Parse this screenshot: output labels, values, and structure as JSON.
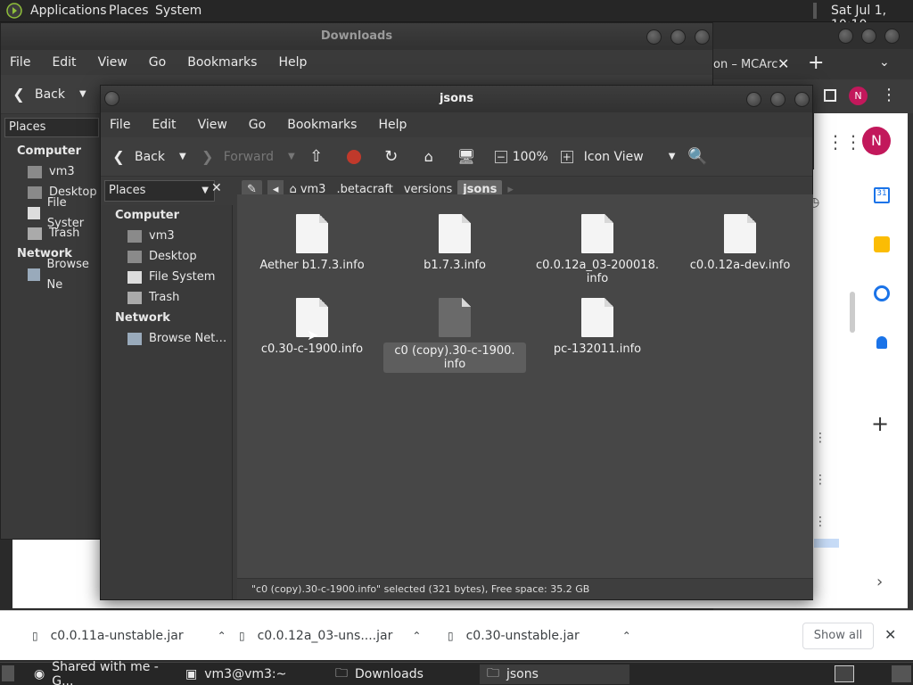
{
  "top_panel": {
    "applications": "Applications",
    "places": "Places",
    "system": "System",
    "clock": "Sat Jul 1, 10:10"
  },
  "chrome": {
    "tab_title": "on – MCArc",
    "new_tab": "+",
    "avatar_letter": "N",
    "downloads": [
      {
        "name": "c0.0.11a-unstable.jar"
      },
      {
        "name": "c0.0.12a_03-uns....jar"
      },
      {
        "name": "c0.30-unstable.jar"
      }
    ],
    "show_all": "Show all"
  },
  "back_window": {
    "title": "Downloads",
    "menu": [
      "File",
      "Edit",
      "View",
      "Go",
      "Bookmarks",
      "Help"
    ],
    "back_label": "Back",
    "places_label": "Places",
    "sidebar": {
      "computer": "Computer",
      "items": [
        "vm3",
        "Desktop",
        "File Syster",
        "Trash"
      ],
      "network": "Network",
      "net_items": [
        "Browse Ne"
      ]
    }
  },
  "front_window": {
    "title": "jsons",
    "menu": [
      "File",
      "Edit",
      "View",
      "Go",
      "Bookmarks",
      "Help"
    ],
    "toolbar": {
      "back": "Back",
      "forward": "Forward",
      "zoom": "100%",
      "view": "Icon View"
    },
    "places_label": "Places",
    "breadcrumbs": [
      "vm3",
      ".betacraft",
      "versions",
      "jsons"
    ],
    "sidebar": {
      "computer": "Computer",
      "items": [
        "vm3",
        "Desktop",
        "File System",
        "Trash"
      ],
      "network": "Network",
      "net_items": [
        "Browse Net…"
      ]
    },
    "files": [
      {
        "name": "Aether b1.7.3.info"
      },
      {
        "name": "b1.7.3.info"
      },
      {
        "name": "c0.0.12a_03-200018.\ninfo"
      },
      {
        "name": "c0.0.12a-dev.info"
      },
      {
        "name": "c0.30-c-1900.info"
      },
      {
        "name": "c0 (copy).30-c-1900.\ninfo",
        "selected": true
      },
      {
        "name": "pc-132011.info"
      }
    ],
    "status": "\"c0 (copy).30-c-1900.info\" selected (321 bytes), Free space: 35.2 GB"
  },
  "taskbar": [
    {
      "label": "Shared with me - G..."
    },
    {
      "label": "vm3@vm3:~"
    },
    {
      "label": "Downloads"
    },
    {
      "label": "jsons"
    }
  ]
}
